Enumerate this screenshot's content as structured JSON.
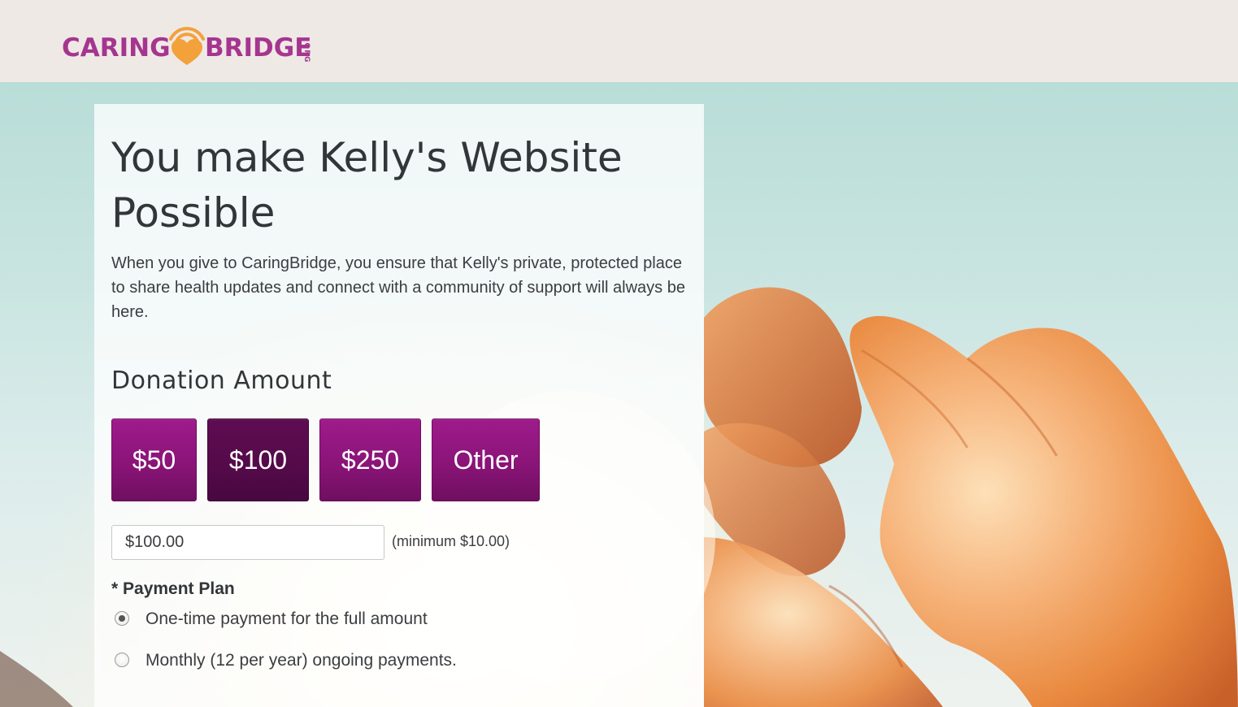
{
  "brand": {
    "logo_left": "CARING",
    "logo_right": "BRIDGE",
    "logo_suffix": ".ORG",
    "accent_color": "#a5358f",
    "heart_color": "#f3a13a"
  },
  "hero": {
    "title": "You make Kelly's Website Possible",
    "intro": "When you give to CaringBridge, you ensure that Kelly's private, protected place to share health updates and connect with a community of support will always be here."
  },
  "donation": {
    "heading": "Donation Amount",
    "options": [
      "$50",
      "$100",
      "$250",
      "Other"
    ],
    "selected": "$100",
    "amount_value": "$100.00",
    "minimum_note": "(minimum $10.00)"
  },
  "payment_plan": {
    "label": "* Payment Plan",
    "options": [
      {
        "label": "One-time payment for the full amount",
        "checked": true
      },
      {
        "label": "Monthly (12 per year) ongoing payments.",
        "checked": false
      }
    ]
  }
}
